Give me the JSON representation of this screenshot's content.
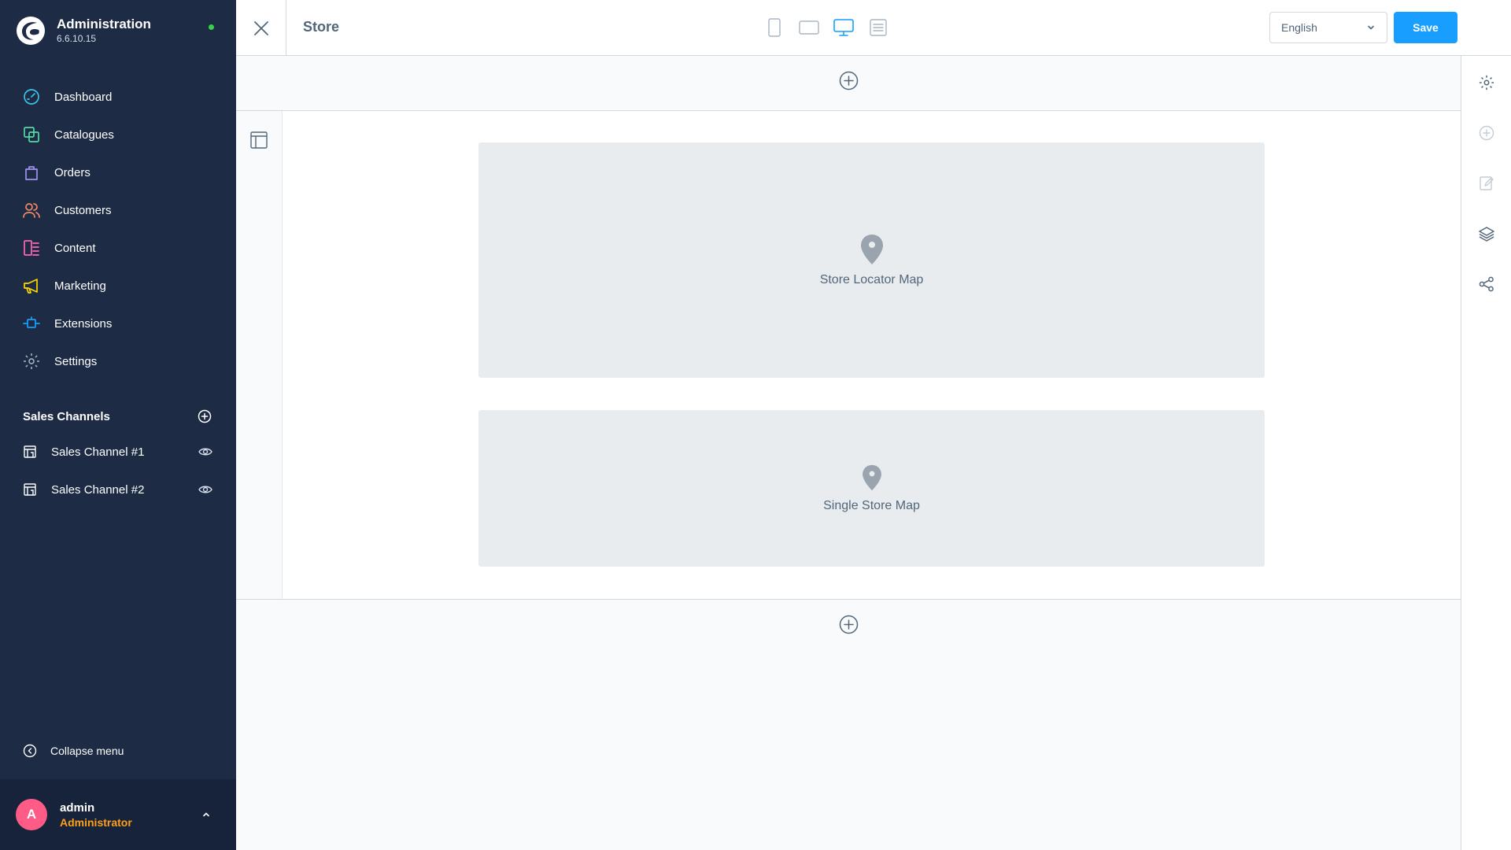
{
  "brand": {
    "title": "Administration",
    "version": "6.6.10.15"
  },
  "nav": [
    {
      "label": "Dashboard",
      "icon": "gauge-icon",
      "color": "#3ac4e6"
    },
    {
      "label": "Catalogues",
      "icon": "catalogue-icon",
      "color": "#57d9a3"
    },
    {
      "label": "Orders",
      "icon": "shopping-bag-icon",
      "color": "#a092f0"
    },
    {
      "label": "Customers",
      "icon": "users-icon",
      "color": "#f88962"
    },
    {
      "label": "Content",
      "icon": "content-icon",
      "color": "#ff68b4"
    },
    {
      "label": "Marketing",
      "icon": "megaphone-icon",
      "color": "#ffd700"
    },
    {
      "label": "Extensions",
      "icon": "plugin-icon",
      "color": "#189eff"
    },
    {
      "label": "Settings",
      "icon": "gear-icon",
      "color": "#9aa8b5"
    }
  ],
  "sales_channels": {
    "title": "Sales Channels",
    "items": [
      {
        "label": "Sales Channel #1"
      },
      {
        "label": "Sales Channel #2"
      }
    ]
  },
  "collapse": {
    "label": "Collapse menu"
  },
  "user": {
    "initial": "A",
    "name": "admin",
    "role": "Administrator"
  },
  "topbar": {
    "title": "Store",
    "language": "English",
    "save_label": "Save"
  },
  "blocks": [
    {
      "label": "Store Locator Map"
    },
    {
      "label": "Single Store Map"
    }
  ],
  "colors": {
    "accent": "#189eff",
    "sidebar": "#1d2b45",
    "role": "#ff9f1a",
    "status": "#37d046"
  }
}
